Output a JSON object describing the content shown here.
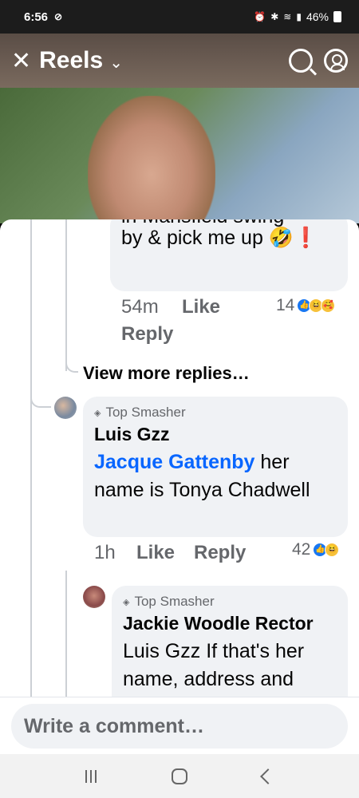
{
  "status": {
    "time": "6:56",
    "battery": "46%"
  },
  "header": {
    "title": "Reels"
  },
  "comments": [
    {
      "text_partial_top": "in Mansfield swing",
      "text": "by & pick me up 🤣❗",
      "time": "54m",
      "like_label": "Like",
      "reply_label": "Reply",
      "reaction_count": "14"
    },
    {
      "view_more": "View more replies…"
    },
    {
      "badge": "Top Smasher",
      "author": "Luis Gzz",
      "mention": "Jacque Gattenby",
      "text": " her name is Tonya Chadwell",
      "time": "1h",
      "like_label": "Like",
      "reply_label": "Reply",
      "reaction_count": "42"
    },
    {
      "badge": "Top Smasher",
      "author": "Jackie Woodle Rector",
      "text": "Luis Gzz If that's her name, address and"
    }
  ],
  "composer": {
    "placeholder": "Write a comment…"
  },
  "colors": {
    "accent": "#0866ff",
    "bubble": "#f0f2f5",
    "meta": "#65676b"
  }
}
